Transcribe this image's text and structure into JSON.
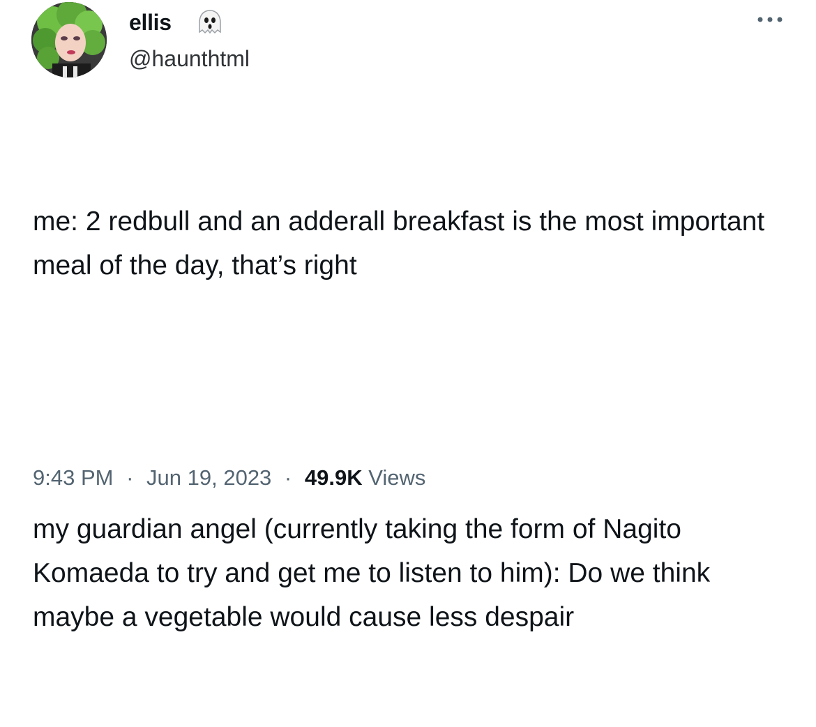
{
  "author": {
    "display_name": "ellis",
    "emoji_icon": "ghost-icon",
    "handle": "@haunthtml"
  },
  "menu": {
    "icon": "more-icon"
  },
  "tweet": {
    "paragraphs": [
      "me: 2 redbull and an adderall breakfast is the most important meal of the day, that’s right",
      "my guardian angel (currently taking the form of Nagito Komaeda to try and get me to listen to him): Do we think maybe a vegetable would cause less despair"
    ]
  },
  "meta": {
    "time": "9:43 PM",
    "separator": "·",
    "date": "Jun 19, 2023",
    "views_count": "49.9K",
    "views_label": "Views"
  },
  "colors": {
    "text_primary": "#0f1419",
    "text_secondary": "#536471",
    "avatar_hair": "#5fa83a"
  }
}
